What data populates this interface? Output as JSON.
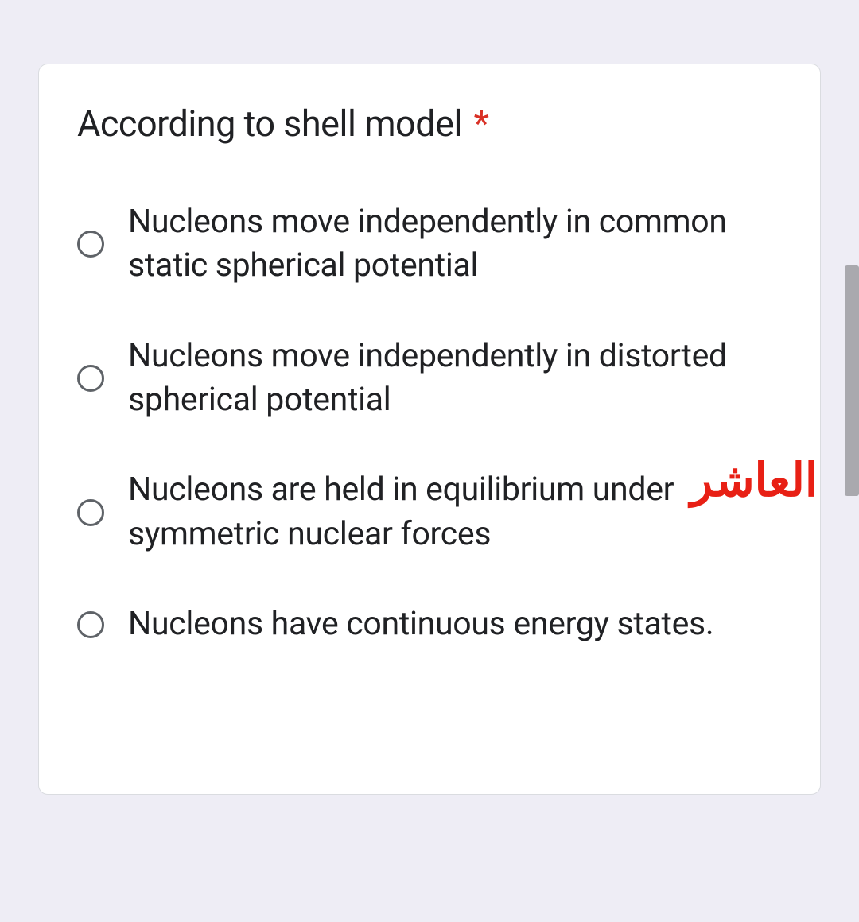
{
  "question": {
    "title": "According to shell model",
    "required_marker": "*",
    "options": [
      "Nucleons move independently in common static spherical potential",
      "Nucleons move independently in distorted spherical potential",
      "Nucleons are held in equilibrium under symmetric nuclear forces",
      "Nucleons have continuous energy states."
    ]
  },
  "overlay": {
    "text": "العاشر"
  }
}
